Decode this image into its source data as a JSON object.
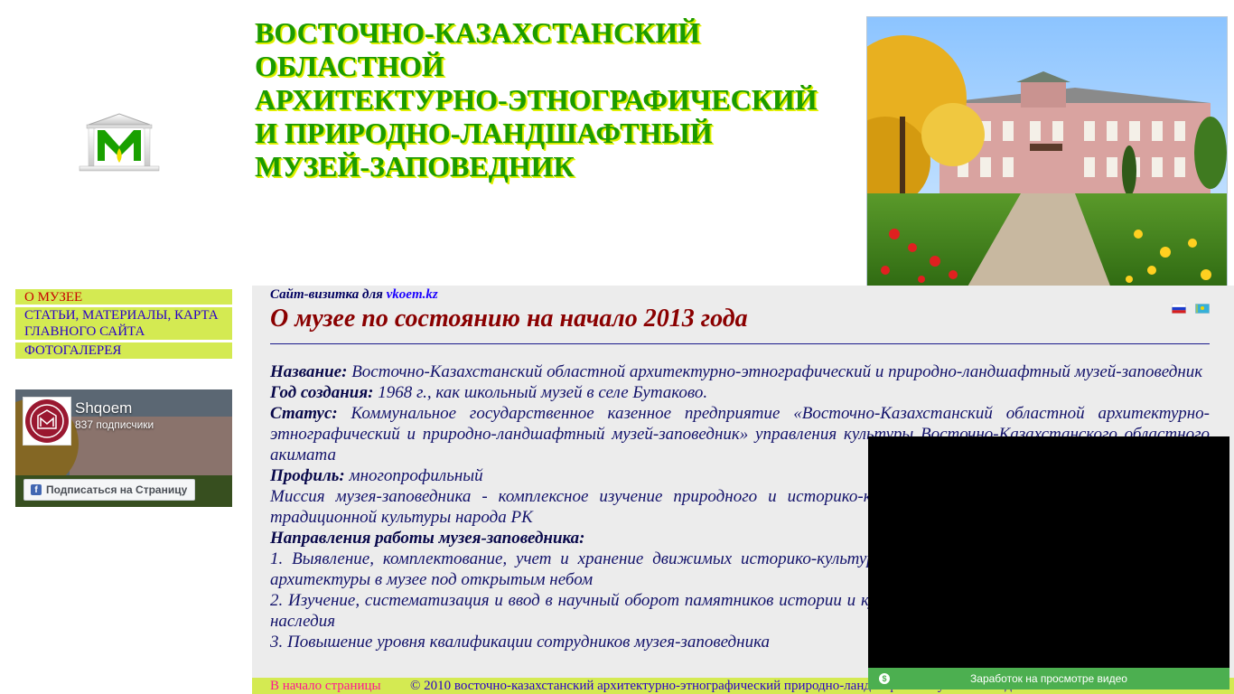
{
  "header": {
    "title_lines": [
      "ВОСТОЧНО-КАЗАХСТАНСКИЙ",
      "ОБЛАСТНОЙ",
      "АРХИТЕКТУРНО-ЭТНОГРАФИЧЕСКИЙ",
      "И ПРИРОДНО-ЛАНДШАФТНЫЙ",
      "МУЗЕЙ-ЗАПОВЕДНИК"
    ],
    "logo_icon": "museum-logo-icon",
    "photo": "museum-building-photo"
  },
  "sidebar": {
    "items": [
      {
        "label": "О МУЗЕЕ"
      },
      {
        "label": "СТАТЬИ, МАТЕРИАЛЫ, КАРТА ГЛАВНОГО САЙТА"
      },
      {
        "label": "ФОТОГАЛЕРЕЯ"
      }
    ]
  },
  "facebook": {
    "page_name": "Shqoem",
    "subscribers": "837 подписчики",
    "subscribe_label": "Подписаться на Страницу"
  },
  "main": {
    "site_card_prefix": "Сайт-визитка для ",
    "site_card_link": "vkoem.kz",
    "page_title": "О музее по состоянию на начало 2013 года",
    "name_label": "Название:",
    "name_value": " Восточно-Казахстанский областной архитектурно-этнографический и природно-ландшафтный музей-заповедник",
    "year_label": "Год создания:",
    "year_value": " 1968 г., как школьный музей в селе Бутаково.",
    "status_label": "Статус:",
    "status_value": " Коммунальное государственное казенное предприятие «Восточно-Казахстанский областной архитектурно-этнографический и природно-ландшафтный музей-заповедник» управления культуры Восточно-Казахстанского областного акимата",
    "profile_label": "Профиль:",
    "profile_value": " многопрофильный",
    "mission": "Миссия музея-заповедника - комплексное изучение природного и историко-культурного наследия как составной части традиционной культуры народа РК",
    "directions_label": "Направления работы музея-заповедника:",
    "direction_1": "1. Выявление, комплектование, учет и хранение движимых историко-культурных ценностей и недвижимых памятников архитектуры в музее под открытым небом",
    "direction_2": "2. Изучение, систематизация и ввод в научный оборот памятников истории и культуры, природного и историко-культурного наследия",
    "direction_3": "3. Повышение уровня квалификации сотрудников музея-заповедника"
  },
  "footer": {
    "to_top": "В начало страницы",
    "copyright": "© 2010 восточно-казахстанский архитектурно-этнографический природно-ландшафтный музей-заповедник"
  },
  "video": {
    "bar_label": "Заработок на просмотре видео"
  },
  "colors": {
    "title_green": "#1b9b00",
    "nav_bg": "#d4ea52",
    "main_bg": "#ececec",
    "heading_red": "#8a0000"
  }
}
